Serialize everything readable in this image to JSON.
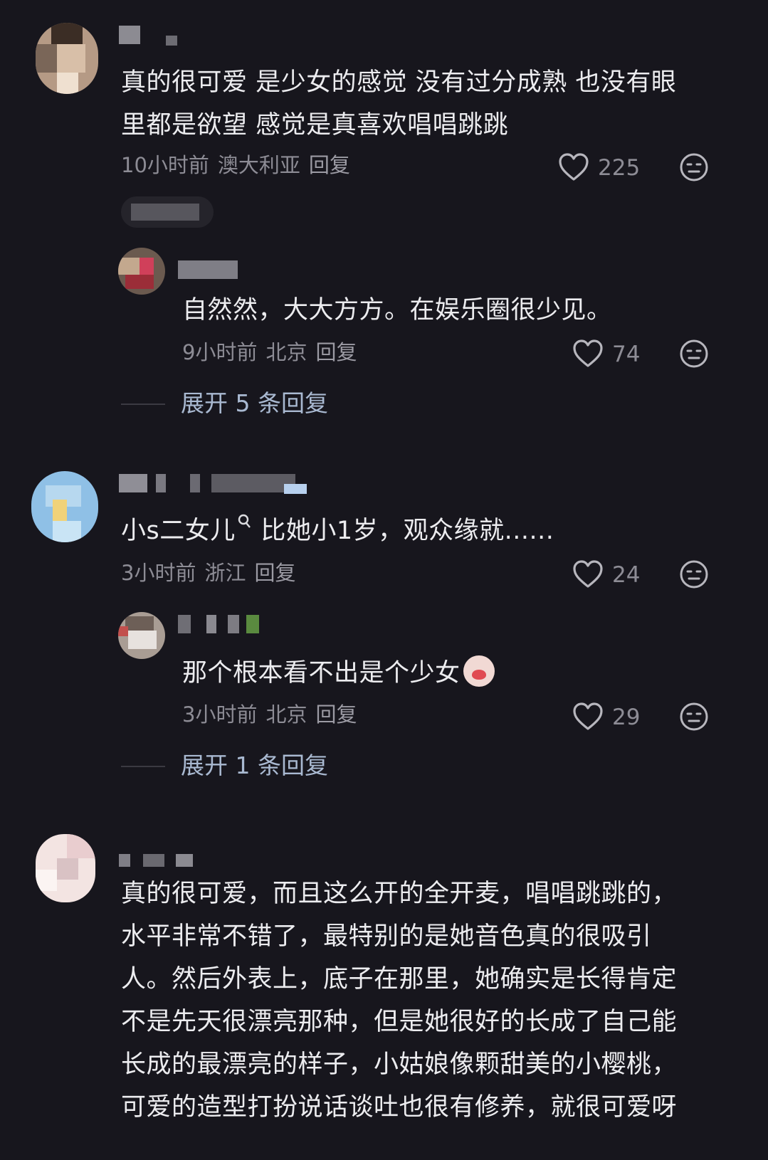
{
  "comments": [
    {
      "text_lines": [
        "真的很可爱 是少女的感觉 没有过分成熟  也没有眼",
        "里都是欲望 感觉是真喜欢唱唱跳跳"
      ],
      "time": "10小时前",
      "location": "澳大利亚",
      "reply_label": "回复",
      "likes": "225"
    },
    {
      "text_lines": [
        "自然然，大大方方。在娱乐圈很少见。"
      ],
      "time": "9小时前",
      "location": "北京",
      "reply_label": "回复",
      "likes": "74",
      "expand_label": "展开 5 条回复"
    },
    {
      "text_pre": "小s二女儿",
      "text_post": " 比她小1岁，观众缘就......",
      "time": "3小时前",
      "location": "浙江",
      "reply_label": "回复",
      "likes": "24"
    },
    {
      "text_lines": [
        "那个根本看不出是个少女"
      ],
      "time": "3小时前",
      "location": "北京",
      "reply_label": "回复",
      "likes": "29",
      "expand_label": "展开 1 条回复"
    },
    {
      "text_lines": [
        "真的很可爱，而且这么开的全开麦，唱唱跳跳的，",
        "水平非常不错了，最特别的是她音色真的很吸引",
        "人。然后外表上，底子在那里，她确实是长得肯定",
        "不是先天很漂亮那种，但是她很好的长成了自己能",
        "长成的最漂亮的样子，小姑娘像颗甜美的小樱桃，",
        "可爱的造型打扮说话谈吐也很有修养，就很可爱呀"
      ]
    }
  ],
  "icons": {
    "like": "heart-outline-icon",
    "dislike": "neutral-face-icon",
    "search_marker": "search-icon"
  }
}
